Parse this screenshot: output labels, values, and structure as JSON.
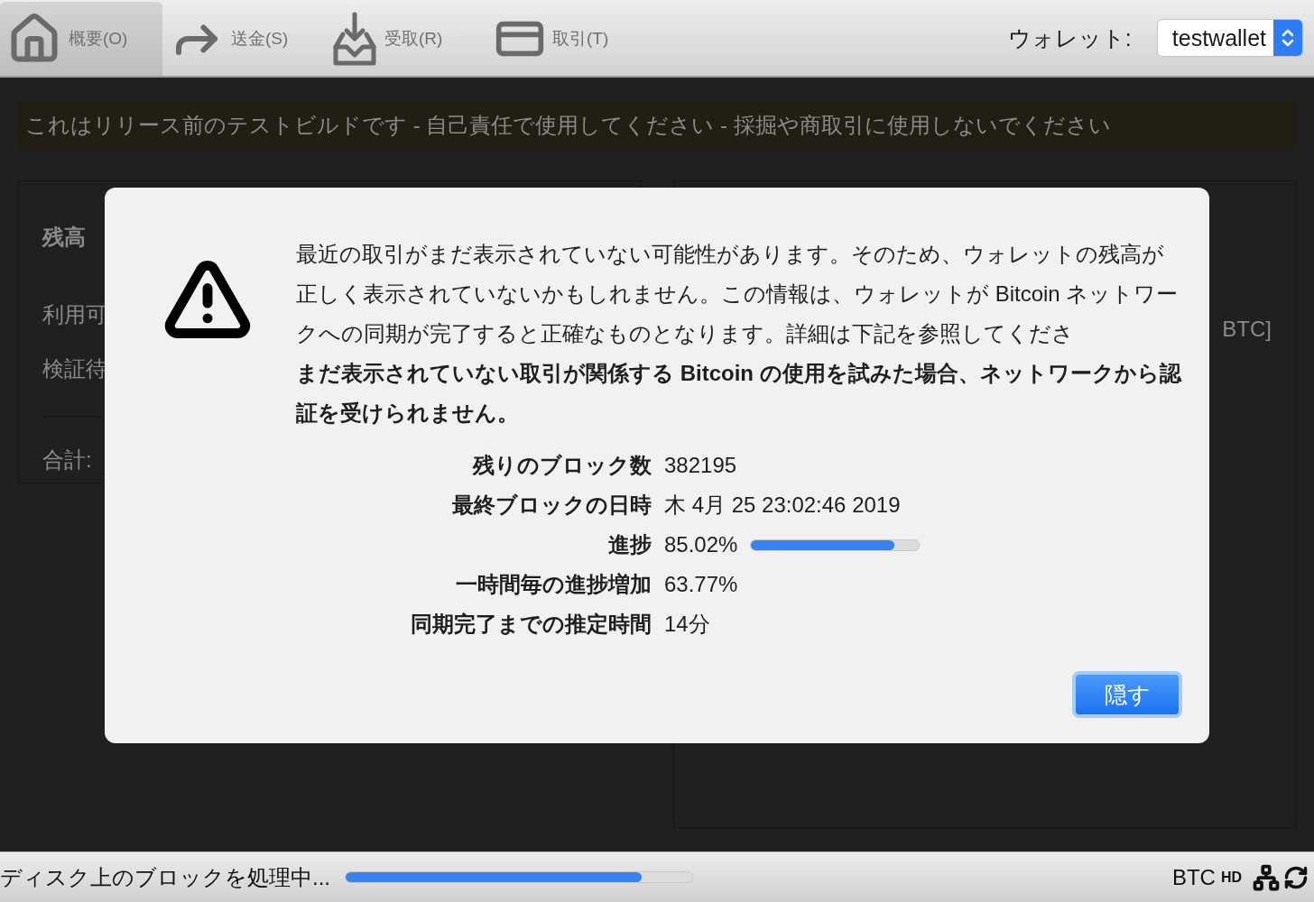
{
  "toolbar": {
    "tabs": [
      {
        "label": "概要(O)",
        "selected": true
      },
      {
        "label": "送金(S)",
        "selected": false
      },
      {
        "label": "受取(R)",
        "selected": false
      },
      {
        "label": "取引(T)",
        "selected": false
      }
    ],
    "wallet_label": "ウォレット:",
    "wallet_value": "testwallet"
  },
  "banner": "これはリリース前のテストビルドです - 自己責任で使用してください - 採掘や商取引に使用しないでください",
  "balance_panel": {
    "title": "残高",
    "rows": [
      "利用可",
      "検証待"
    ],
    "total": "合計:"
  },
  "transactions_panel": {
    "amount": "BTC]"
  },
  "sync_dialog": {
    "message": "最近の取引がまだ表示されていない可能性があります。そのため、ウォレットの残高が正しく表示されていないかもしれません。この情報は、ウォレットが Bitcoin ネットワークへの同期が完了すると正確なものとなります。詳細は下記を参照してくださ",
    "warning": "まだ表示されていない取引が関係する Bitcoin の使用を試みた場合、ネットワークから認証を受けられません。",
    "rows": [
      {
        "label": "残りのブロック数",
        "value": "382195"
      },
      {
        "label": "最終ブロックの日時",
        "value": "木 4月 25 23:02:46 2019"
      },
      {
        "label": "進捗",
        "value": "85.02%",
        "level": 0.8502
      },
      {
        "label": "一時間毎の進捗増加",
        "value": "63.77%"
      },
      {
        "label": "同期完了までの推定時間",
        "value": "14分"
      }
    ],
    "button": "隠す"
  },
  "status_bar": {
    "text": "ディスク上のブロックを処理中...",
    "level": 0.854,
    "unit": "BTC",
    "hd": "HD"
  }
}
